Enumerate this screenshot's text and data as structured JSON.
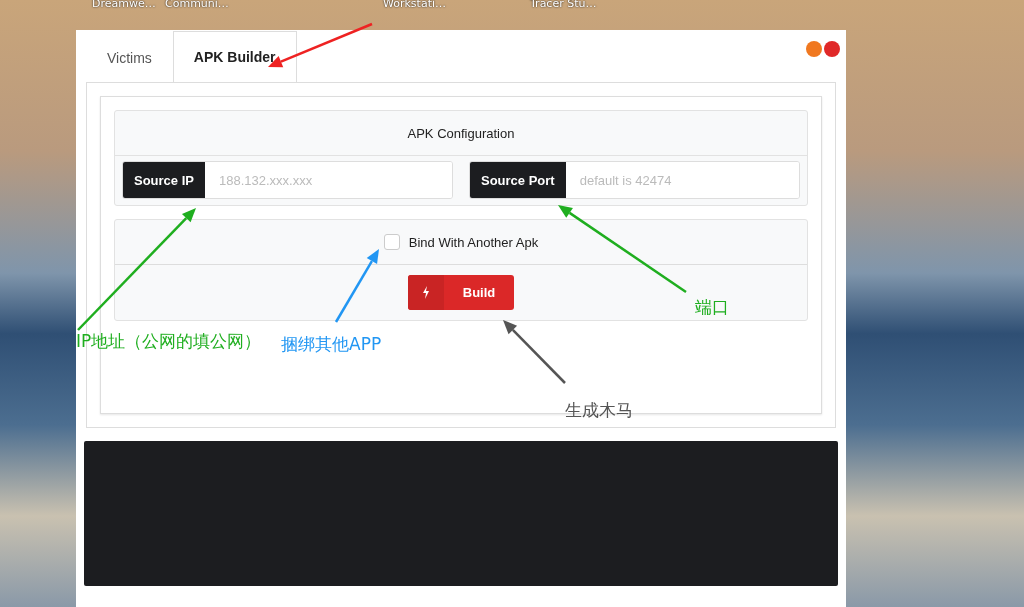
{
  "desktop": {
    "icon_labels": [
      "Dreamwe…",
      "Communi…",
      "Workstati…",
      "Tracer Stu…"
    ]
  },
  "window": {
    "tabs": [
      {
        "label": "Victims",
        "selected": false
      },
      {
        "label": "APK Builder",
        "selected": true
      }
    ],
    "config": {
      "title": "APK Configuration",
      "fields": [
        {
          "label": "Source IP",
          "placeholder": "188.132.xxx.xxx"
        },
        {
          "label": "Source Port",
          "placeholder": "default is 42474"
        }
      ]
    },
    "bind": {
      "label": "Bind With Another Apk",
      "checked": false
    },
    "build_button": "Build"
  },
  "annotations": [
    {
      "text": "IP地址（公网的填公网）",
      "color": "#1fae1f"
    },
    {
      "text": "捆绑其他APP",
      "color": "#2196f3"
    },
    {
      "text": "端口",
      "color": "#1fae1f"
    },
    {
      "text": "生成木马",
      "color": "#555555"
    }
  ]
}
